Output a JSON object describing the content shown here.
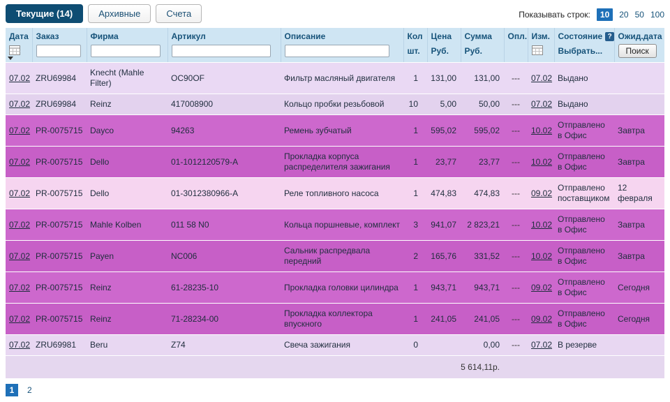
{
  "tabs": [
    {
      "label": "Текущие (14)",
      "active": true
    },
    {
      "label": "Архивные",
      "active": false
    },
    {
      "label": "Счета",
      "active": false
    }
  ],
  "rows_per_page": {
    "label": "Показывать строк:",
    "options": [
      "10",
      "20",
      "50",
      "100"
    ],
    "selected": "10"
  },
  "table": {
    "headers": {
      "date": "Дата",
      "order": "Заказ",
      "firm": "Фирма",
      "article": "Артикул",
      "description": "Описание",
      "qty": "Кол",
      "qty_sub": "шт.",
      "price": "Цена",
      "price_sub": "Руб.",
      "sum": "Сумма",
      "sum_sub": "Руб.",
      "paid": "Опл.",
      "modified": "Изм.",
      "status": "Состояние",
      "status_help": "?",
      "status_filter": "Выбрать...",
      "wait_date": "Ожид.дата",
      "search": "Поиск"
    },
    "rows": [
      {
        "date": "07.02",
        "order": "ZRU69984",
        "firm": "Knecht (Mahle Filter)",
        "article": "OC90OF",
        "description": "Фильтр масляный двигателя",
        "qty": "1",
        "price": "131,00",
        "sum": "131,00",
        "paid": "---",
        "modified": "07.02",
        "status": "Выдано",
        "wait": "",
        "bg": "#ead9f4"
      },
      {
        "date": "07.02",
        "order": "ZRU69984",
        "firm": "Reinz",
        "article": "417008900",
        "description": "Кольцо пробки резьбовой",
        "qty": "10",
        "price": "5,00",
        "sum": "50,00",
        "paid": "---",
        "modified": "07.02",
        "status": "Выдано",
        "wait": "",
        "bg": "#e3d2ee"
      },
      {
        "date": "07.02",
        "order": "PR-0075715",
        "firm": "Dayco",
        "article": "94263",
        "description": "Ремень зубчатый",
        "qty": "1",
        "price": "595,02",
        "sum": "595,02",
        "paid": "---",
        "modified": "10.02",
        "status": "Отправлено в Офис",
        "wait": "Завтра",
        "bg": "#cd68cd"
      },
      {
        "date": "07.02",
        "order": "PR-0075715",
        "firm": "Dello",
        "article": "01-1012120579-A",
        "description": "Прокладка корпуса распределителя зажигания",
        "qty": "1",
        "price": "23,77",
        "sum": "23,77",
        "paid": "---",
        "modified": "10.02",
        "status": "Отправлено в Офис",
        "wait": "Завтра",
        "bg": "#c75fc7"
      },
      {
        "date": "07.02",
        "order": "PR-0075715",
        "firm": "Dello",
        "article": "01-3012380966-A",
        "description": "Реле топливного насоса",
        "qty": "1",
        "price": "474,83",
        "sum": "474,83",
        "paid": "---",
        "modified": "09.02",
        "status": "Отправлено поставщиком",
        "wait": "12 февраля",
        "bg": "#f6d5f0"
      },
      {
        "date": "07.02",
        "order": "PR-0075715",
        "firm": "Mahle Kolben",
        "article": "011 58 N0",
        "description": "Кольца поршневые, комплект",
        "qty": "3",
        "price": "941,07",
        "sum": "2 823,21",
        "paid": "---",
        "modified": "10.02",
        "status": "Отправлено в Офис",
        "wait": "Завтра",
        "bg": "#cd68cd"
      },
      {
        "date": "07.02",
        "order": "PR-0075715",
        "firm": "Payen",
        "article": "NC006",
        "description": "Сальник распредвала передний",
        "qty": "2",
        "price": "165,76",
        "sum": "331,52",
        "paid": "---",
        "modified": "10.02",
        "status": "Отправлено в Офис",
        "wait": "Завтра",
        "bg": "#c75fc7"
      },
      {
        "date": "07.02",
        "order": "PR-0075715",
        "firm": "Reinz",
        "article": "61-28235-10",
        "description": "Прокладка головки цилиндра",
        "qty": "1",
        "price": "943,71",
        "sum": "943,71",
        "paid": "---",
        "modified": "09.02",
        "status": "Отправлено в Офис",
        "wait": "Сегодня",
        "bg": "#cd68cd"
      },
      {
        "date": "07.02",
        "order": "PR-0075715",
        "firm": "Reinz",
        "article": "71-28234-00",
        "description": "Прокладка коллектора впускного",
        "qty": "1",
        "price": "241,05",
        "sum": "241,05",
        "paid": "---",
        "modified": "09.02",
        "status": "Отправлено в Офис",
        "wait": "Сегодня",
        "bg": "#c75fc7"
      },
      {
        "date": "07.02",
        "order": "ZRU69981",
        "firm": "Beru",
        "article": "Z74",
        "description": "Свеча зажигания",
        "qty": "0",
        "price": "",
        "sum": "0,00",
        "paid": "---",
        "modified": "07.02",
        "status": "В резерве",
        "wait": "",
        "bg": "#e8d7f2"
      }
    ],
    "total_label": "5 614,11р."
  },
  "pagination": {
    "pages": [
      "1",
      "2"
    ],
    "current": "1"
  },
  "colors": {
    "header_bg": "#cfe5f3",
    "header_text": "#17537a",
    "tab_active_bg": "#0e4d73",
    "selected_box_bg": "#1e70b8",
    "row_issued_bg": "#ead9f4",
    "row_sent_office_bg": "#cd68cd",
    "row_sent_supplier_bg": "#f6d5f0",
    "total_row_bg": "#e5d7ef"
  }
}
